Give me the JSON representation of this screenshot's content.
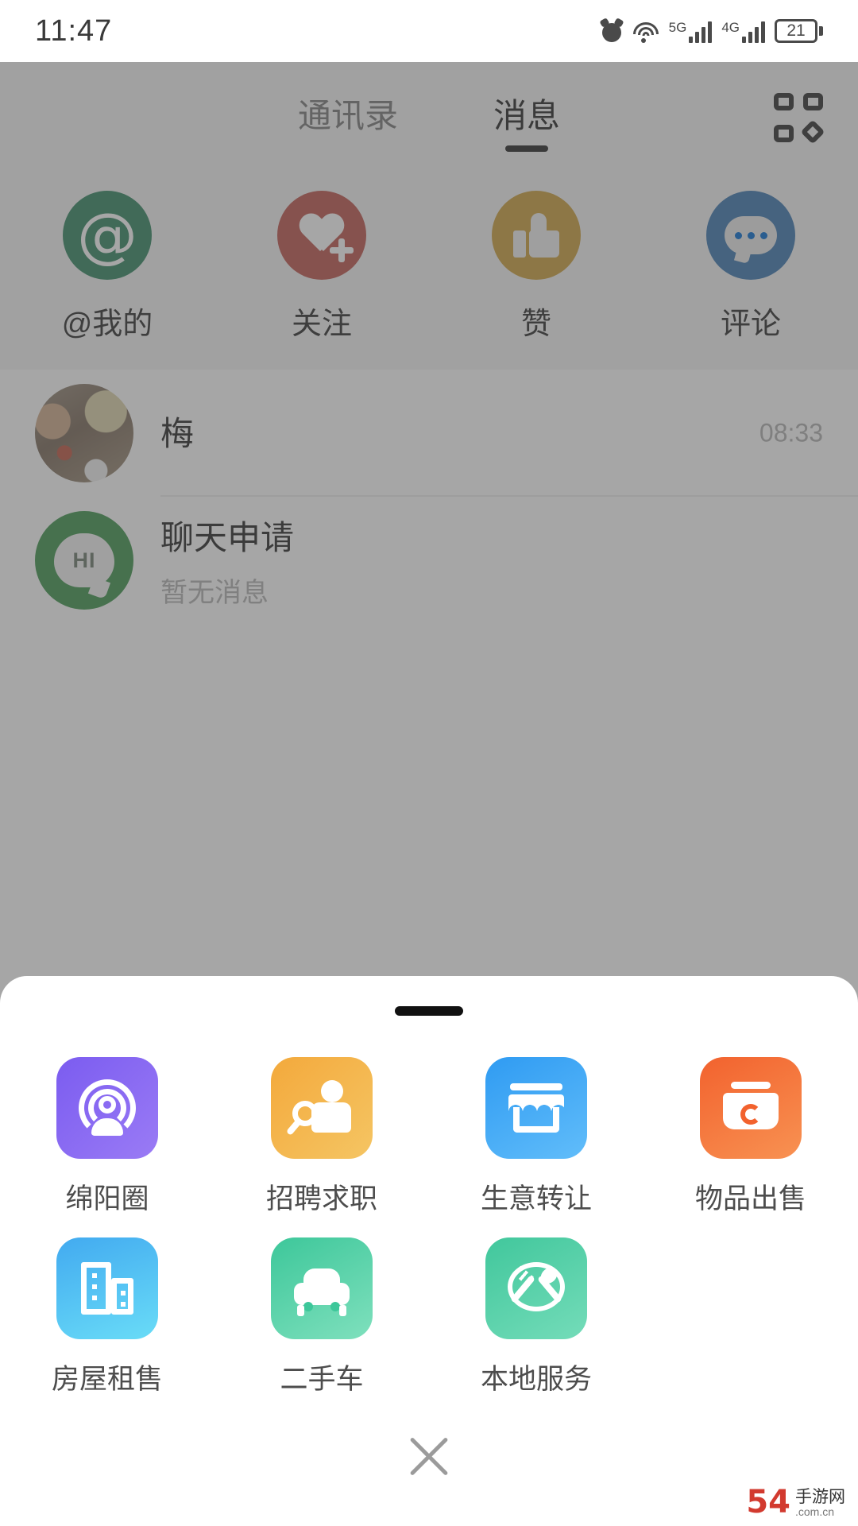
{
  "status_bar": {
    "time": "11:47",
    "battery_level": "21",
    "network_left": "5G",
    "network_right": "4G",
    "icons": [
      "alarm-icon",
      "wifi-icon",
      "signal-5g-icon",
      "signal-4g-icon",
      "battery-icon"
    ]
  },
  "header": {
    "tabs": [
      {
        "label": "通讯录",
        "active": false
      },
      {
        "label": "消息",
        "active": true
      }
    ],
    "grid_button": "grid-apps-icon"
  },
  "shortcuts": [
    {
      "label": "@我的",
      "icon": "at-icon",
      "color": "#1f7a52"
    },
    {
      "label": "关注",
      "icon": "heart-plus-icon",
      "color": "#b8453c"
    },
    {
      "label": "赞",
      "icon": "thumbs-up-icon",
      "color": "#c8982a"
    },
    {
      "label": "评论",
      "icon": "comment-icon",
      "color": "#2a6aa8"
    }
  ],
  "chats": [
    {
      "name": "梅",
      "subtitle": "",
      "time": "08:33",
      "avatar": "photo-avatar"
    },
    {
      "name": "聊天申请",
      "subtitle": "暂无消息",
      "time": "",
      "avatar": "hi-bubble-avatar",
      "avatar_text": "HI"
    }
  ],
  "sheet": {
    "handle": "drag-handle",
    "apps": [
      {
        "label": "绵阳圈",
        "icon": "broadcast-person-icon",
        "tile": "t-mianyang"
      },
      {
        "label": "招聘求职",
        "icon": "job-search-icon",
        "tile": "t-zhaopin"
      },
      {
        "label": "生意转让",
        "icon": "storefront-icon",
        "tile": "t-shengyi"
      },
      {
        "label": "物品出售",
        "icon": "recycle-basket-icon",
        "tile": "t-wupin"
      },
      {
        "label": "房屋租售",
        "icon": "buildings-icon",
        "tile": "t-fangwu"
      },
      {
        "label": "二手车",
        "icon": "car-icon",
        "tile": "t-ershou"
      },
      {
        "label": "本地服务",
        "icon": "dining-plate-icon",
        "tile": "t-bendi"
      }
    ],
    "close_button": "close-x-icon"
  },
  "watermark": {
    "number": "54",
    "main": "手游网",
    "sub": ".com.cn"
  }
}
